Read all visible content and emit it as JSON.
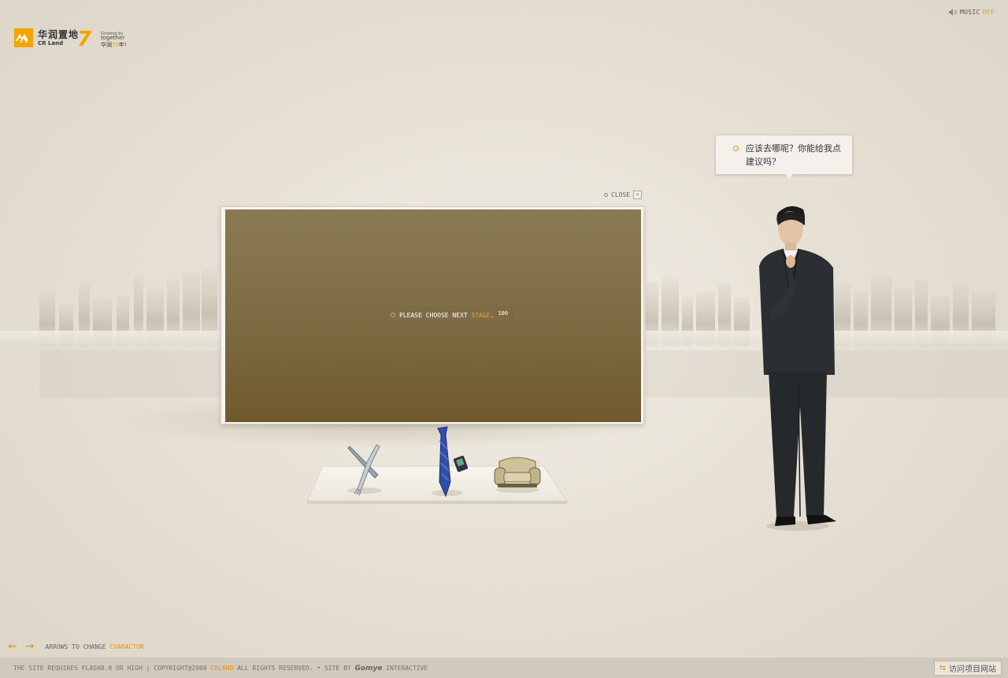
{
  "logo": {
    "name_cn": "华润置地",
    "name_en": "CR Land",
    "anniversary_small": "Growing by",
    "anniversary_together": "together",
    "anniversary_cn_prefix": "华润",
    "anniversary_cn_years": "70",
    "anniversary_cn_suffix": "年!"
  },
  "music": {
    "label": "MUSIC",
    "state": "OFF"
  },
  "character": {
    "speech": "应该去哪呢？你能给我点建议吗？"
  },
  "screen": {
    "close_label": "CLOSE",
    "prompt_prefix": "PLEASE CHOOSE NEXT ",
    "prompt_accent": "STAGE",
    "prompt_suffix": ".",
    "counter": "100"
  },
  "options": [
    {
      "name": "dining",
      "icon": "fork-knife-icon"
    },
    {
      "name": "work",
      "icon": "necktie-icon"
    },
    {
      "name": "home",
      "icon": "sofa-icon"
    }
  ],
  "navigation": {
    "prev_icon": "arrow-left-icon",
    "next_icon": "arrow-right-icon",
    "hint_prefix": "ARROWS TO CHANGE ",
    "hint_accent": "CHARACTOR"
  },
  "footer": {
    "requirement": "THE SITE REQUIRES FLASH8.0 OR HIGH",
    "separator": " | ",
    "copyright_prefix": "COPYRIGHT@2008 ",
    "copyright_accent": "CRLAND",
    "copyright_suffix": " ALL RIGHTS RESERVED.",
    "bullet": " • ",
    "site_by": "SITE BY ",
    "agency": "Gomye",
    "agency_suffix": " INTERACTIVE",
    "visit_label": "访问项目网站"
  },
  "colors": {
    "accent": "#e8921a",
    "logo_orange": "#f5a300",
    "screen_top": "#8a7a54",
    "screen_bottom": "#6f5a2c",
    "footer_bg": "#d0c9bd"
  }
}
